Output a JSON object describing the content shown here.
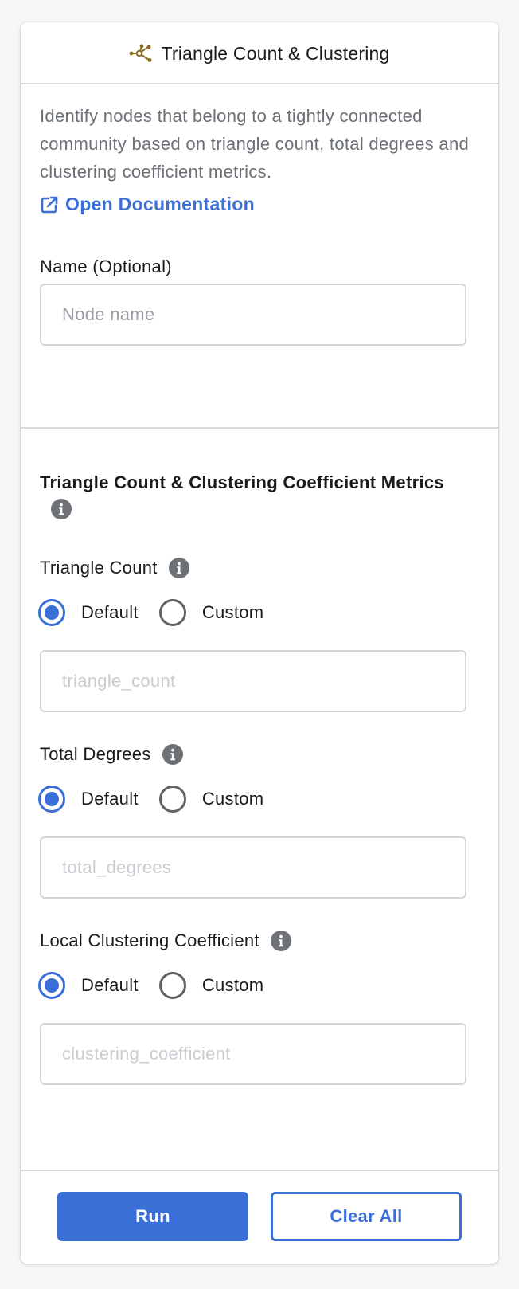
{
  "header": {
    "title": "Triangle Count & Clustering",
    "icon": "graph-nodes-icon",
    "icon_color": "#8a6a1e"
  },
  "intro": {
    "description": "Identify nodes that belong to a tightly connected community based on triangle count, total degrees and clustering coefficient metrics.",
    "doc_link_label": "Open Documentation",
    "doc_link_icon": "external-link-icon"
  },
  "name_field": {
    "label": "Name (Optional)",
    "value": "",
    "placeholder": "Node name"
  },
  "metrics": {
    "title": "Triangle Count & Clustering Coefficient Metrics",
    "groups": [
      {
        "label": "Triangle Count",
        "options": [
          "Default",
          "Custom"
        ],
        "selected": "Default",
        "placeholder": "triangle_count"
      },
      {
        "label": "Total Degrees",
        "options": [
          "Default",
          "Custom"
        ],
        "selected": "Default",
        "placeholder": "total_degrees"
      },
      {
        "label": "Local Clustering Coefficient",
        "options": [
          "Default",
          "Custom"
        ],
        "selected": "Default",
        "placeholder": "clustering_coefficient"
      }
    ]
  },
  "footer": {
    "run_label": "Run",
    "clear_label": "Clear All"
  },
  "colors": {
    "accent": "#3a6fd8",
    "info_icon": "#6e7176",
    "divider": "#d6d9de"
  }
}
